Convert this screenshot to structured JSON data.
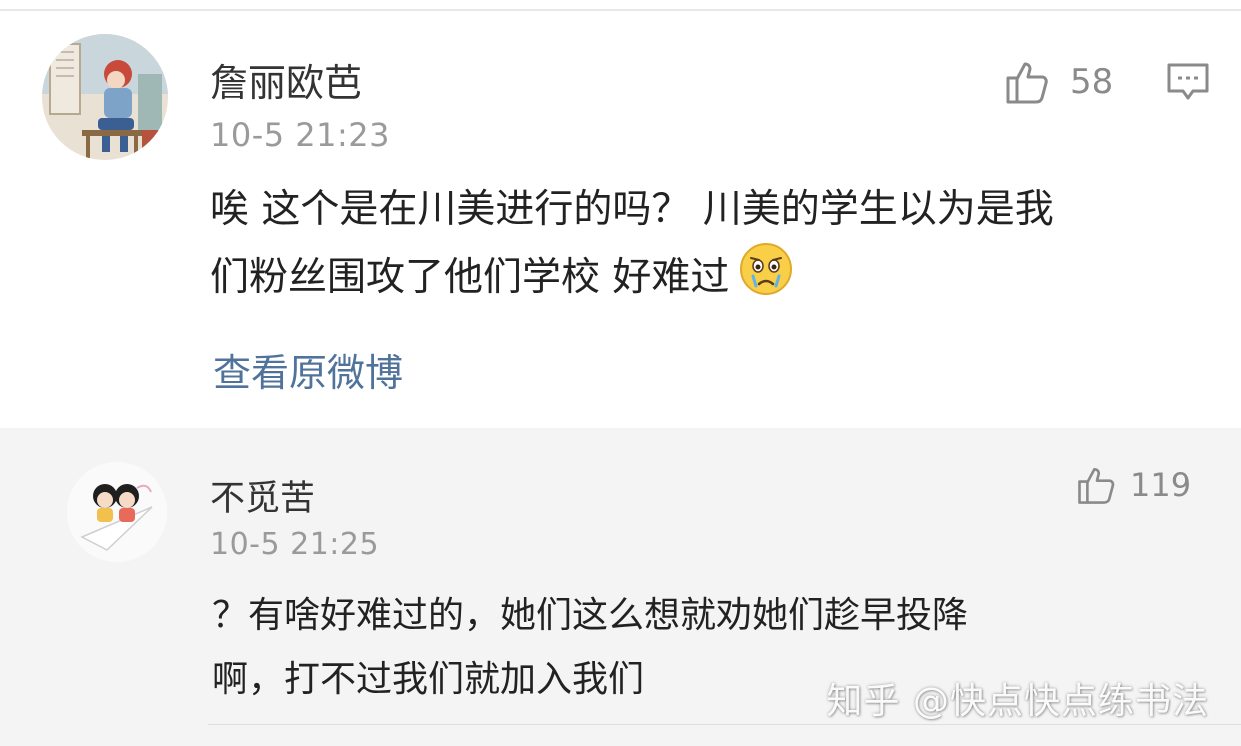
{
  "comments": [
    {
      "username": "詹丽欧芭",
      "time": "10-5 21:23",
      "likes": "58",
      "body_lines": [
        "唉 这个是在川美进行的吗？ 川美的学生以为是我",
        "们粉丝围攻了他们学校 好难过"
      ],
      "emoji": "crying-face-emoji",
      "view_original": "查看原微博",
      "avatar": "anime-girl-avatar"
    },
    {
      "username": "不觅苦",
      "time": "10-5 21:25",
      "likes": "119",
      "body_lines": [
        "？有啥好难过的，她们这么想就劝她们趁早投降",
        "啊，打不过我们就加入我们"
      ],
      "avatar": "cartoon-couple-avatar"
    }
  ],
  "watermark": "知乎 @快点快点练书法",
  "colors": {
    "link": "#50739c",
    "meta": "#9a9a9a",
    "reply_bg": "#f4f4f4"
  }
}
